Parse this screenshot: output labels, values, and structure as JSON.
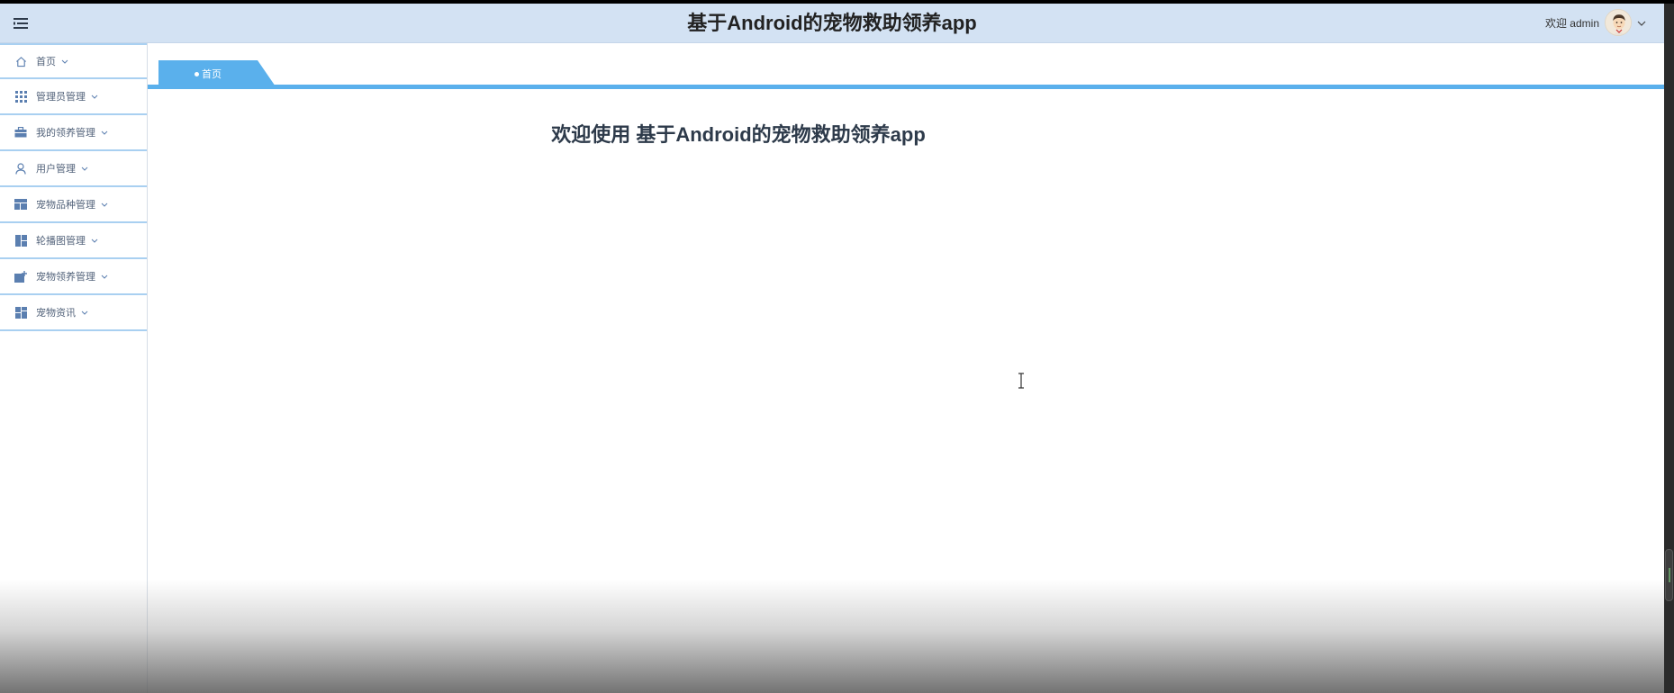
{
  "header": {
    "title": "基于Android的宠物救助领养app",
    "welcome": "欢迎 admin",
    "menu_icon": "hamburger-menu-icon",
    "avatar_icon": "user-avatar",
    "dropdown_icon": "chevron-down-icon"
  },
  "sidebar": {
    "items": [
      {
        "label": "首页",
        "icon": "home-icon"
      },
      {
        "label": "管理员管理",
        "icon": "grid-icon"
      },
      {
        "label": "我的领养管理",
        "icon": "briefcase-icon"
      },
      {
        "label": "用户管理",
        "icon": "user-icon"
      },
      {
        "label": "宠物品种管理",
        "icon": "layout-icon"
      },
      {
        "label": "轮播图管理",
        "icon": "dashboard-icon"
      },
      {
        "label": "宠物领养管理",
        "icon": "image-add-icon"
      },
      {
        "label": "宠物资讯",
        "icon": "blocks-icon"
      }
    ]
  },
  "tabs": [
    {
      "label": "首页",
      "active": true
    }
  ],
  "main": {
    "welcome_heading": "欢迎使用 基于Android的宠物救助领养app"
  },
  "colors": {
    "header_bg": "#d3e2f3",
    "accent": "#5ab0ec",
    "sidebar_border": "#a9d0f1",
    "icon": "#5b7fb0"
  }
}
